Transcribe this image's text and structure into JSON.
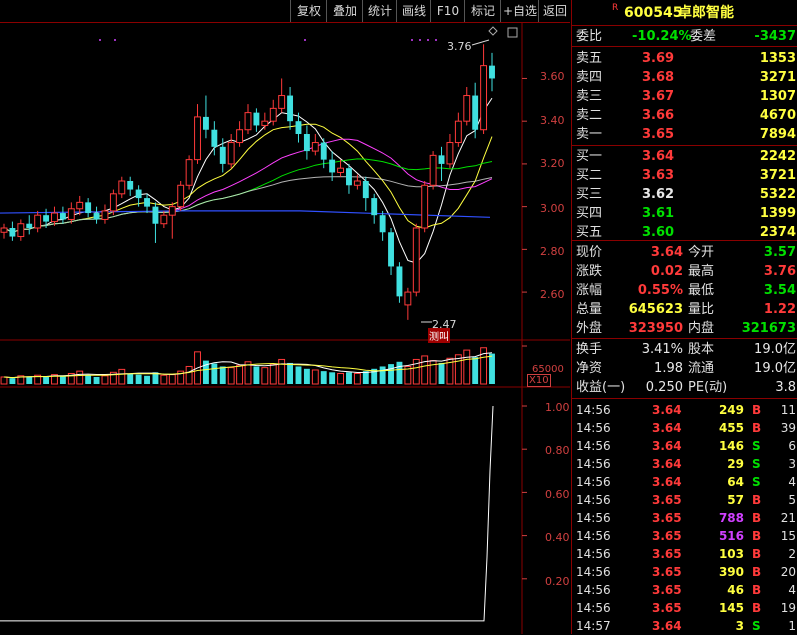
{
  "toolbar": {
    "buttons": [
      "复权",
      "叠加",
      "统计",
      "画线",
      "F10",
      "标记",
      "+自选",
      "返回"
    ]
  },
  "header": {
    "badge": "R",
    "code": "600545",
    "name": "卓郎智能"
  },
  "chart": {
    "price_axis": [
      "3.60",
      "3.40",
      "3.20",
      "3.00",
      "2.80",
      "2.60"
    ],
    "high_marker": "3.76",
    "low_marker": "2.47",
    "low_tag": "测叫",
    "volume_axis": "65000",
    "volume_unit": "X10",
    "indicator_axis": [
      "1.00",
      "0.80",
      "0.60",
      "0.40",
      "0.20"
    ]
  },
  "chart_data": {
    "type": "candlestick",
    "ylim": [
      2.47,
      3.76
    ],
    "candles": [
      [
        2.88,
        2.9,
        2.85,
        2.92
      ],
      [
        2.9,
        2.86,
        2.84,
        2.93
      ],
      [
        2.86,
        2.92,
        2.84,
        2.94
      ],
      [
        2.92,
        2.9,
        2.87,
        2.96
      ],
      [
        2.9,
        2.96,
        2.88,
        2.98
      ],
      [
        2.96,
        2.93,
        2.9,
        2.99
      ],
      [
        2.93,
        2.97,
        2.91,
        3.0
      ],
      [
        2.97,
        2.94,
        2.92,
        3.0
      ],
      [
        2.94,
        2.99,
        2.92,
        3.02
      ],
      [
        2.99,
        3.02,
        2.96,
        3.05
      ],
      [
        3.02,
        2.97,
        2.95,
        3.04
      ],
      [
        2.97,
        2.94,
        2.92,
        3.0
      ],
      [
        2.94,
        2.98,
        2.92,
        3.01
      ],
      [
        2.98,
        3.06,
        2.96,
        3.08
      ],
      [
        3.06,
        3.12,
        3.04,
        3.14
      ],
      [
        3.12,
        3.08,
        3.05,
        3.14
      ],
      [
        3.08,
        3.04,
        3.0,
        3.1
      ],
      [
        3.04,
        3.0,
        2.97,
        3.06
      ],
      [
        3.0,
        2.92,
        2.83,
        3.02
      ],
      [
        2.92,
        2.96,
        2.9,
        2.98
      ],
      [
        2.96,
        3.0,
        2.85,
        3.02
      ],
      [
        3.0,
        3.1,
        2.98,
        3.12
      ],
      [
        3.1,
        3.22,
        3.08,
        3.24
      ],
      [
        3.22,
        3.42,
        3.2,
        3.48
      ],
      [
        3.42,
        3.36,
        3.32,
        3.52
      ],
      [
        3.36,
        3.28,
        3.24,
        3.4
      ],
      [
        3.28,
        3.2,
        3.16,
        3.32
      ],
      [
        3.2,
        3.3,
        3.18,
        3.34
      ],
      [
        3.3,
        3.36,
        3.28,
        3.4
      ],
      [
        3.36,
        3.44,
        3.34,
        3.48
      ],
      [
        3.44,
        3.38,
        3.35,
        3.46
      ],
      [
        3.38,
        3.4,
        3.36,
        3.44
      ],
      [
        3.4,
        3.46,
        3.38,
        3.5
      ],
      [
        3.46,
        3.52,
        3.44,
        3.6
      ],
      [
        3.52,
        3.4,
        3.36,
        3.56
      ],
      [
        3.4,
        3.34,
        3.3,
        3.44
      ],
      [
        3.34,
        3.26,
        3.22,
        3.38
      ],
      [
        3.26,
        3.3,
        3.24,
        3.34
      ],
      [
        3.3,
        3.22,
        3.18,
        3.32
      ],
      [
        3.22,
        3.16,
        3.12,
        3.26
      ],
      [
        3.16,
        3.18,
        3.14,
        3.22
      ],
      [
        3.18,
        3.1,
        3.06,
        3.2
      ],
      [
        3.1,
        3.12,
        3.08,
        3.15
      ],
      [
        3.12,
        3.04,
        2.98,
        3.14
      ],
      [
        3.04,
        2.96,
        2.92,
        3.06
      ],
      [
        2.96,
        2.88,
        2.84,
        2.98
      ],
      [
        2.88,
        2.72,
        2.68,
        2.9
      ],
      [
        2.72,
        2.58,
        2.55,
        2.74
      ],
      [
        2.54,
        2.6,
        2.47,
        2.62
      ],
      [
        2.6,
        2.9,
        2.58,
        2.92
      ],
      [
        2.9,
        3.1,
        2.88,
        3.12
      ],
      [
        3.1,
        3.24,
        3.08,
        3.26
      ],
      [
        3.24,
        3.2,
        3.12,
        3.28
      ],
      [
        3.2,
        3.3,
        3.18,
        3.34
      ],
      [
        3.3,
        3.4,
        3.28,
        3.44
      ],
      [
        3.4,
        3.52,
        3.38,
        3.56
      ],
      [
        3.52,
        3.36,
        3.32,
        3.58
      ],
      [
        3.36,
        3.66,
        3.34,
        3.76
      ],
      [
        3.66,
        3.6,
        3.54,
        3.72
      ]
    ],
    "volumes": [
      12,
      10,
      14,
      13,
      15,
      12,
      16,
      14,
      18,
      22,
      15,
      12,
      14,
      20,
      25,
      18,
      16,
      14,
      20,
      15,
      16,
      22,
      30,
      55,
      40,
      35,
      30,
      28,
      32,
      38,
      30,
      28,
      34,
      42,
      36,
      30,
      26,
      24,
      22,
      20,
      18,
      20,
      18,
      22,
      26,
      30,
      34,
      38,
      30,
      42,
      48,
      40,
      36,
      44,
      50,
      58,
      46,
      62,
      52
    ]
  },
  "quote": {
    "weibi_label": "委比",
    "weibi_value": "-10.24%",
    "weicha_label": "委差",
    "weicha_value": "-3437",
    "asks": [
      {
        "label": "卖五",
        "price": "3.69",
        "vol": "1353"
      },
      {
        "label": "卖四",
        "price": "3.68",
        "vol": "3271"
      },
      {
        "label": "卖三",
        "price": "3.67",
        "vol": "1307"
      },
      {
        "label": "卖二",
        "price": "3.66",
        "vol": "4670"
      },
      {
        "label": "卖一",
        "price": "3.65",
        "vol": "7894"
      }
    ],
    "bids": [
      {
        "label": "买一",
        "price": "3.64",
        "vol": "2242"
      },
      {
        "label": "买二",
        "price": "3.63",
        "vol": "3721"
      },
      {
        "label": "买三",
        "price": "3.62",
        "vol": "5322"
      },
      {
        "label": "买四",
        "price": "3.61",
        "vol": "1399"
      },
      {
        "label": "买五",
        "price": "3.60",
        "vol": "2374"
      }
    ],
    "stats": [
      {
        "l1": "现价",
        "v1": "3.64",
        "l2": "今开",
        "v2": "3.57"
      },
      {
        "l1": "涨跌",
        "v1": "0.02",
        "l2": "最高",
        "v2": "3.76"
      },
      {
        "l1": "涨幅",
        "v1": "0.55%",
        "l2": "最低",
        "v2": "3.54"
      },
      {
        "l1": "总量",
        "v1": "645623",
        "l2": "量比",
        "v2": "1.22"
      },
      {
        "l1": "外盘",
        "v1": "323950",
        "l2": "内盘",
        "v2": "321673"
      }
    ],
    "fund": [
      {
        "l1": "换手",
        "v1": "3.41%",
        "l2": "股本",
        "v2": "19.0亿"
      },
      {
        "l1": "净资",
        "v1": "1.98",
        "l2": "流通",
        "v2": "19.0亿"
      },
      {
        "l1": "收益(一)",
        "v1": "0.250",
        "l2": "PE(动)",
        "v2": "3.8"
      }
    ],
    "ticks": [
      {
        "t": "14:56",
        "p": "3.64",
        "v": "249",
        "s": "B",
        "n": "11"
      },
      {
        "t": "14:56",
        "p": "3.64",
        "v": "455",
        "s": "B",
        "n": "39"
      },
      {
        "t": "14:56",
        "p": "3.64",
        "v": "146",
        "s": "S",
        "n": "6"
      },
      {
        "t": "14:56",
        "p": "3.64",
        "v": "29",
        "s": "S",
        "n": "3"
      },
      {
        "t": "14:56",
        "p": "3.64",
        "v": "64",
        "s": "S",
        "n": "4"
      },
      {
        "t": "14:56",
        "p": "3.65",
        "v": "57",
        "s": "B",
        "n": "5"
      },
      {
        "t": "14:56",
        "p": "3.65",
        "v": "788",
        "s": "B",
        "n": "21"
      },
      {
        "t": "14:56",
        "p": "3.65",
        "v": "516",
        "s": "B",
        "n": "15"
      },
      {
        "t": "14:56",
        "p": "3.65",
        "v": "103",
        "s": "B",
        "n": "2"
      },
      {
        "t": "14:56",
        "p": "3.65",
        "v": "390",
        "s": "B",
        "n": "20"
      },
      {
        "t": "14:56",
        "p": "3.65",
        "v": "46",
        "s": "B",
        "n": "4"
      },
      {
        "t": "14:56",
        "p": "3.65",
        "v": "145",
        "s": "B",
        "n": "19"
      },
      {
        "t": "14:57",
        "p": "3.64",
        "v": "3",
        "s": "S",
        "n": "1"
      }
    ]
  },
  "colors": {
    "up": "#ff3a3a",
    "down": "#40e0e0",
    "frame": "#8a0000",
    "accent_yellow": "#ffff40"
  }
}
